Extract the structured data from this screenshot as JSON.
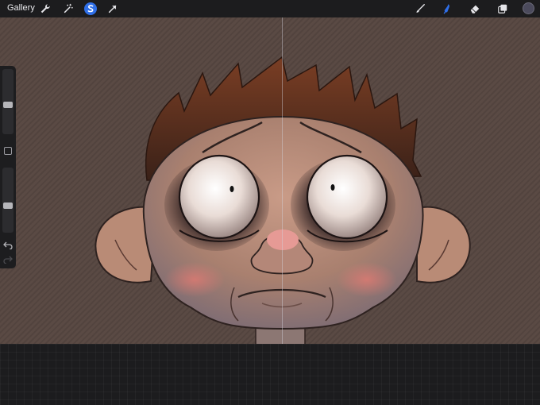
{
  "topbar": {
    "gallery_label": "Gallery",
    "left_tools": [
      "wrench-icon",
      "magic-wand-icon",
      "selection-icon",
      "transform-arrow-icon"
    ],
    "right_tools": [
      "brush-icon",
      "smudge-icon",
      "eraser-icon",
      "layers-icon"
    ],
    "active_tool": "selection-icon",
    "accent_color": "#2f6fe8",
    "current_color": "#4b4a5c"
  },
  "sidebar": {
    "brush_size_level": 0.55,
    "opacity_level": 0.4,
    "icons": [
      "modify-square-icon",
      "undo-icon",
      "redo-icon"
    ]
  },
  "canvas": {
    "background_color": "#5a4a44",
    "symmetry_guide": "vertical"
  }
}
